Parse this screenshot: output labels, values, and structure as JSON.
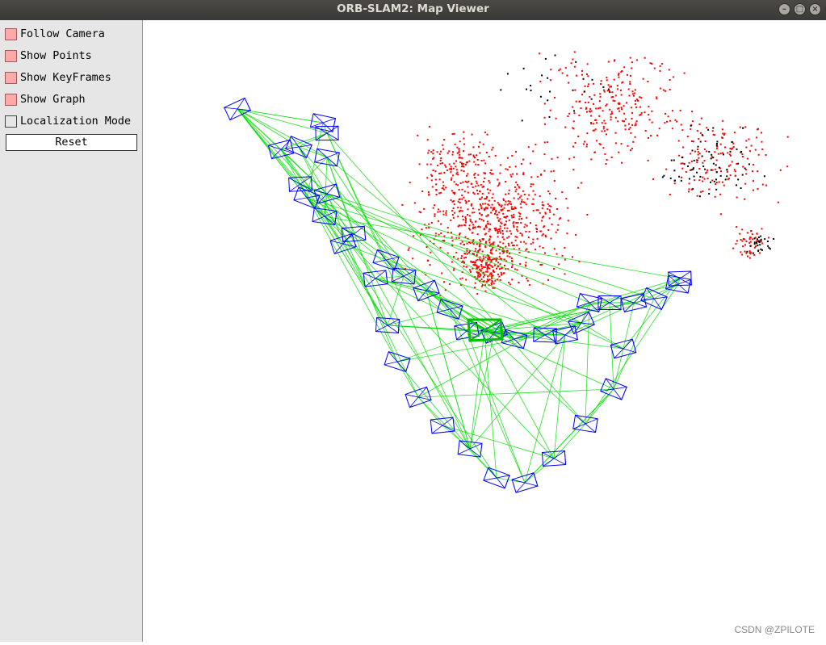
{
  "window": {
    "title": "ORB-SLAM2: Map Viewer",
    "buttons": [
      "minimize",
      "maximize",
      "close"
    ]
  },
  "panel": {
    "options": [
      {
        "label": "Follow Camera",
        "checked": true
      },
      {
        "label": "Show Points",
        "checked": true
      },
      {
        "label": "Show KeyFrames",
        "checked": true
      },
      {
        "label": "Show Graph",
        "checked": true
      },
      {
        "label": "Localization Mode",
        "checked": false
      }
    ],
    "reset_label": "Reset"
  },
  "viewer": {
    "colors": {
      "map_points": "#ff0000",
      "reference_points": "#000000",
      "keyframes": "#0000ff",
      "graph": "#00dd00",
      "current_camera": "#00c000"
    }
  },
  "watermark": "CSDN @ZPILOTE"
}
